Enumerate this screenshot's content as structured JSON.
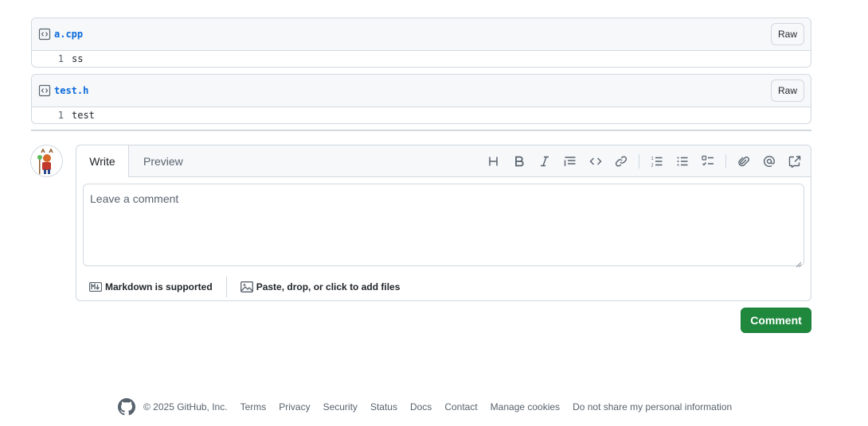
{
  "files": [
    {
      "name": "a.cpp",
      "raw_label": "Raw",
      "lines": [
        {
          "num": "1",
          "code": "ss"
        }
      ]
    },
    {
      "name": "test.h",
      "raw_label": "Raw",
      "lines": [
        {
          "num": "1",
          "code": "test"
        }
      ]
    }
  ],
  "editor": {
    "tabs": {
      "write": "Write",
      "preview": "Preview"
    },
    "toolbar_icons": [
      "heading-icon",
      "bold-icon",
      "italic-icon",
      "quote-icon",
      "code-icon",
      "link-icon",
      "numbered-list-icon",
      "bulleted-list-icon",
      "task-list-icon",
      "attach-icon",
      "mention-icon",
      "reference-icon"
    ],
    "placeholder": "Leave a comment",
    "markdown_label": "Markdown is supported",
    "files_label": "Paste, drop, or click to add files"
  },
  "comment_button": "Comment",
  "footer": {
    "copyright": "© 2025 GitHub, Inc.",
    "links": [
      "Terms",
      "Privacy",
      "Security",
      "Status",
      "Docs",
      "Contact",
      "Manage cookies",
      "Do not share my personal information"
    ]
  },
  "colors": {
    "accent": "#0969da",
    "success": "#1f883d",
    "border": "#d1d9e0",
    "muted": "#59636e"
  }
}
